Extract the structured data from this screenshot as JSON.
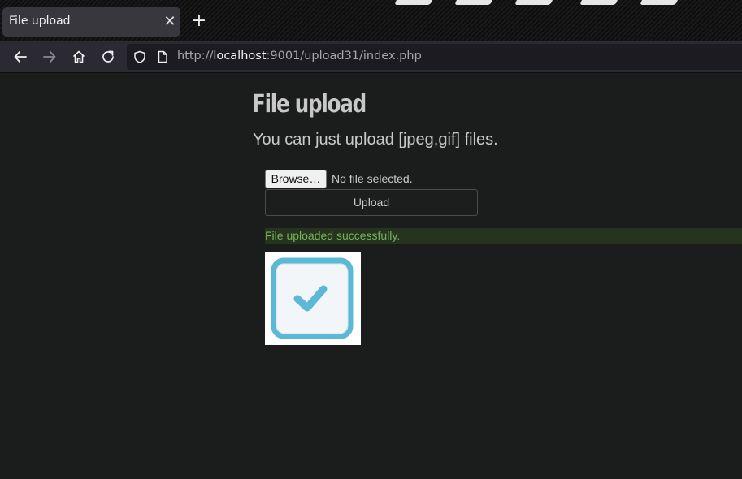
{
  "browser": {
    "tab": {
      "title": "File upload",
      "close_glyph": "✕"
    },
    "new_tab_glyph": "+",
    "nav": {
      "back_icon": "back-arrow-icon",
      "forward_icon": "forward-arrow-icon",
      "home_icon": "home-icon",
      "reload_icon": "reload-icon"
    },
    "url": {
      "scheme": "http://",
      "host": "localhost",
      "rest": ":9001/upload31/index.php"
    }
  },
  "page": {
    "title": "File upload",
    "subtitle": "You can just upload [jpeg,gif] files.",
    "form": {
      "browse_label": "Browse…",
      "file_status": "No file selected.",
      "upload_label": "Upload"
    },
    "message": "File uploaded successfully.",
    "uploaded_image": {
      "icon": "checkbox-checked-icon",
      "accent": "#5bb8d6"
    }
  },
  "colors": {
    "page_bg": "#1b1d1c",
    "toolbar_bg": "#2b2a33",
    "success_text": "#74b45a",
    "success_bg": "#26331f"
  }
}
